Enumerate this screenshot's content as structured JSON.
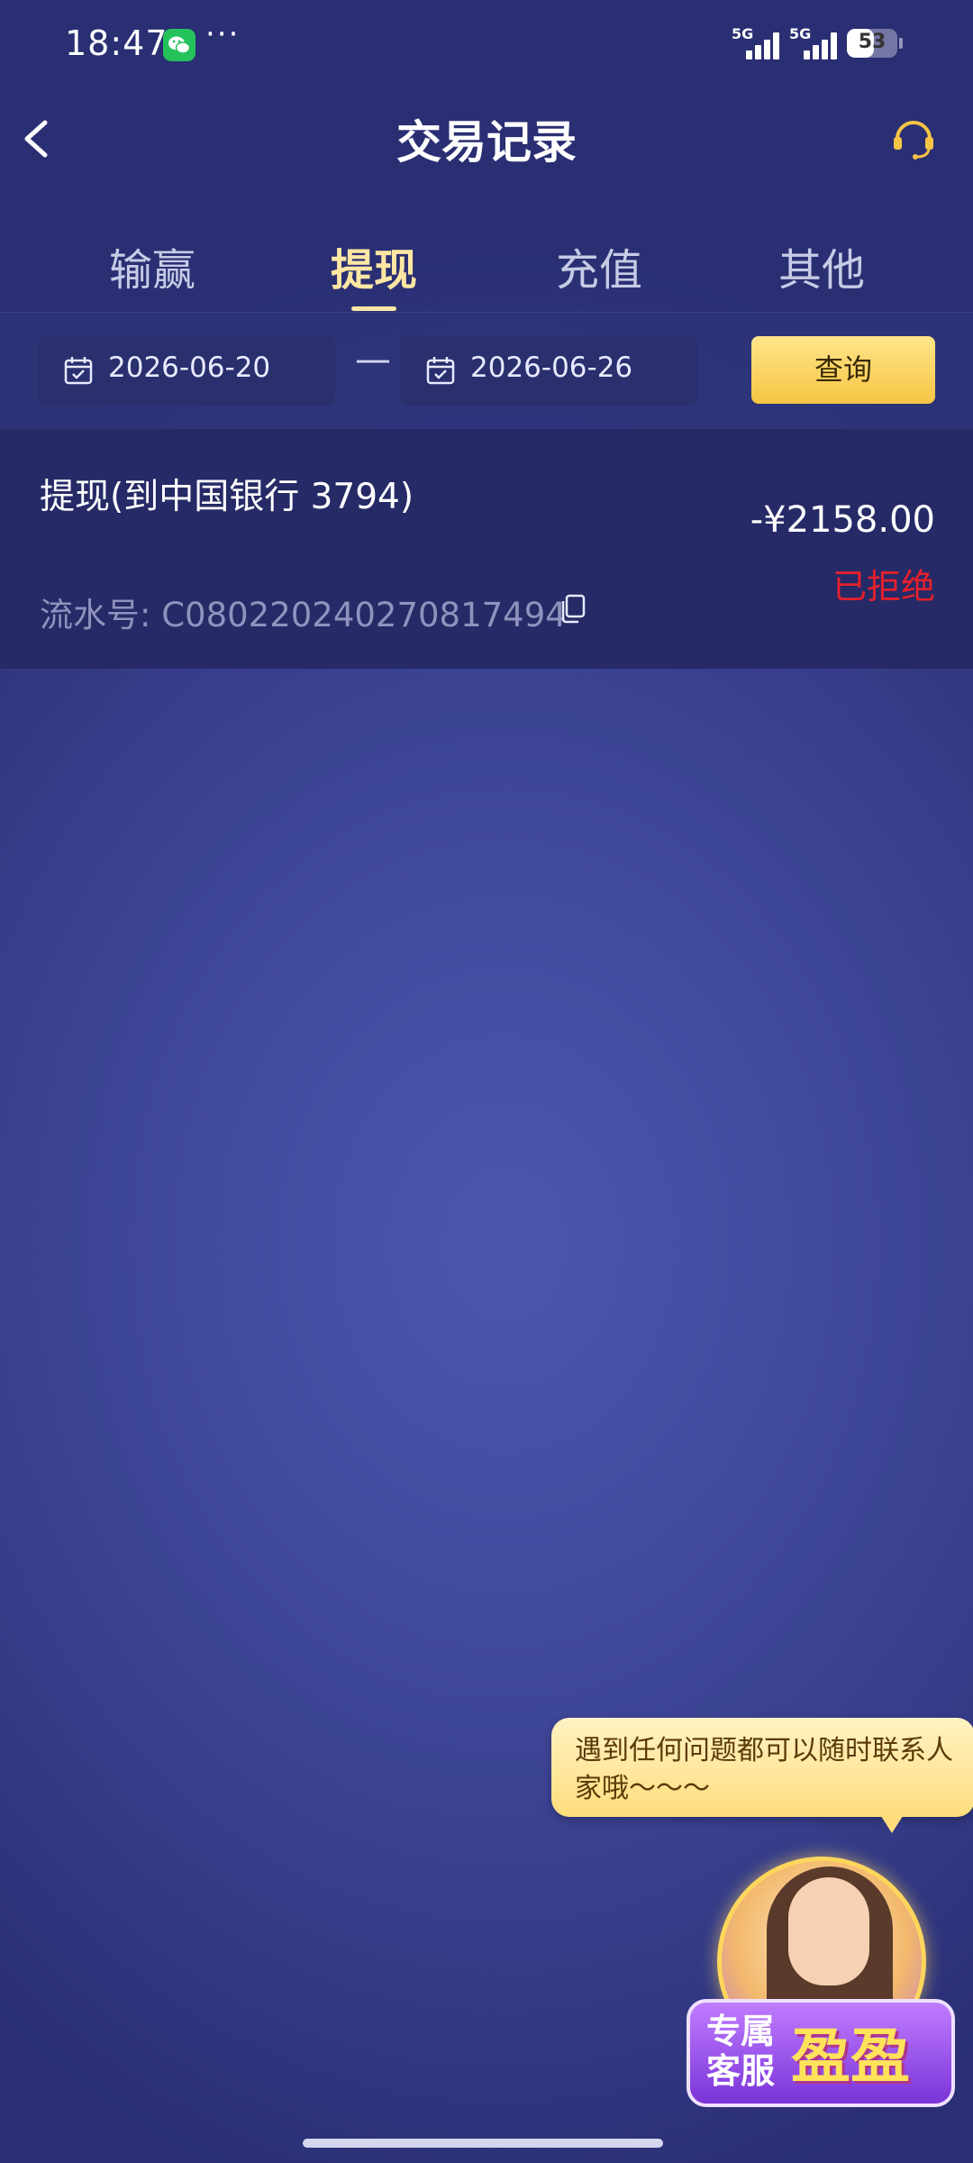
{
  "status_bar": {
    "time": "18:47",
    "more": "···",
    "signal1_label": "5G",
    "signal2_label": "5G",
    "battery_level": "53",
    "battery_fraction": 0.53
  },
  "header": {
    "title": "交易记录",
    "back_icon": "chevron-left-icon",
    "support_icon": "headset-icon"
  },
  "tabs": [
    {
      "label": "输赢",
      "active": false
    },
    {
      "label": "提现",
      "active": true
    },
    {
      "label": "充值",
      "active": false
    },
    {
      "label": "其他",
      "active": false
    }
  ],
  "filter": {
    "start_date": "2026-06-20",
    "separator": "—",
    "end_date": "2026-06-26",
    "query_label": "查询"
  },
  "records": [
    {
      "title": "提现(到中国银行 3794)",
      "amount": "-¥2158.00",
      "status": "已拒绝",
      "serial": "流水号: C080220240270817494"
    }
  ],
  "service": {
    "bubble_text": "遇到任何问题都可以随时联系人家哦～～～",
    "badge_line1": "专属",
    "badge_line2": "客服",
    "badge_name": "盈盈"
  },
  "colors": {
    "accent_gold": "#ffe7a3",
    "status_rejected": "#e6202c",
    "background": "#434b9f"
  }
}
